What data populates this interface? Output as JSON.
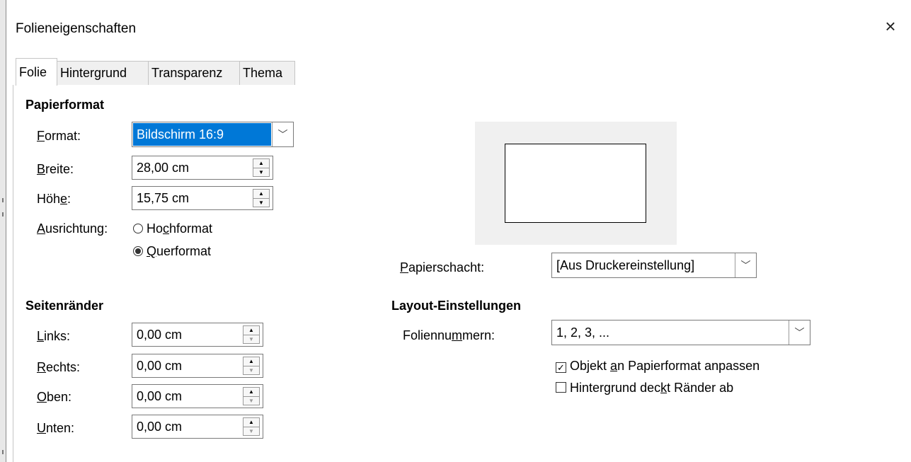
{
  "dialog": {
    "title": "Folieneigenschaften",
    "close_glyph": "×"
  },
  "tabs": [
    {
      "label": "Folie",
      "active": true
    },
    {
      "label": "Hintergrund",
      "active": false
    },
    {
      "label": "Transparenz",
      "active": false
    },
    {
      "label": "Thema",
      "active": false
    }
  ],
  "paper": {
    "heading": "Papierformat",
    "format_label_u": "F",
    "format_label_rest": "ormat:",
    "format_value": "Bildschirm 16:9",
    "width_label_u": "B",
    "width_label_rest": "reite:",
    "width_value": "28,00 cm",
    "height_label_pre": "Höh",
    "height_label_u": "e",
    "height_label_post": ":",
    "height_value": "15,75 cm",
    "orientation_label_u": "A",
    "orientation_label_rest": "usrichtung:",
    "portrait_pre": "Ho",
    "portrait_u": "c",
    "portrait_post": "hformat",
    "landscape_u": "Q",
    "landscape_rest": "uerformat",
    "orientation_selected": "Querformat",
    "tray_label_u": "P",
    "tray_label_rest": "apierschacht:",
    "tray_value": "[Aus Druckereinstellung]"
  },
  "margins": {
    "heading": "Seitenränder",
    "left_label_u": "L",
    "left_label_rest": "inks:",
    "left_value": "0,00 cm",
    "right_label_u": "R",
    "right_label_rest": "echts:",
    "right_value": "0,00 cm",
    "top_label_u": "O",
    "top_label_rest": "ben:",
    "top_value": "0,00 cm",
    "bottom_label_u": "U",
    "bottom_label_rest": "nten:",
    "bottom_value": "0,00 cm"
  },
  "layout": {
    "heading": "Layout-Einstellungen",
    "numbering_label_pre": "Foliennu",
    "numbering_label_u": "m",
    "numbering_label_post": "mern:",
    "numbering_value": "1, 2, 3, ...",
    "fit_pre": "Objekt ",
    "fit_u": "a",
    "fit_post": "n Papierformat anpassen",
    "fit_checked": true,
    "bg_pre": "Hintergrund dec",
    "bg_u": "k",
    "bg_post": "t Ränder ab",
    "bg_checked": false
  },
  "icons": {
    "spin_up": "▲",
    "spin_down": "▼",
    "dropdown": "﹀",
    "checkmark": "✓"
  }
}
